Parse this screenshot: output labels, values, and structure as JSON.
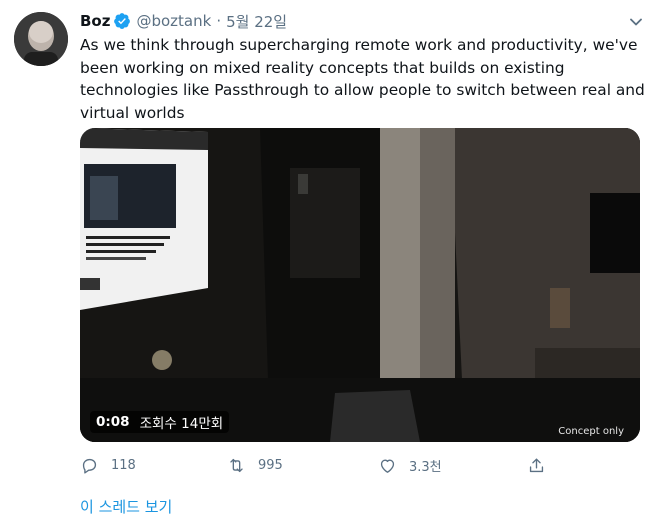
{
  "tweet": {
    "display_name": "Boz",
    "handle": "@boztank",
    "separator": "·",
    "date": "5월 22일",
    "text": "As we think through supercharging remote work and productivity, we've been working on mixed reality concepts that builds on existing technologies like Passthrough to allow people to switch between real and virtual worlds"
  },
  "icons": {
    "verified": "verified-badge-icon",
    "menu": "chevron-down-icon",
    "reply": "reply-icon",
    "retweet": "retweet-icon",
    "like": "heart-icon",
    "share": "share-icon"
  },
  "video": {
    "time": "0:08",
    "views": "조회수 14만회",
    "overlay_label": "Concept only"
  },
  "actions": {
    "reply_count": "118",
    "retweet_count": "995",
    "like_count": "3.3천"
  },
  "thread_link": "이 스레드 보기",
  "colors": {
    "accent": "#1b95e0",
    "muted": "#5b7083",
    "text": "#0f1419"
  }
}
